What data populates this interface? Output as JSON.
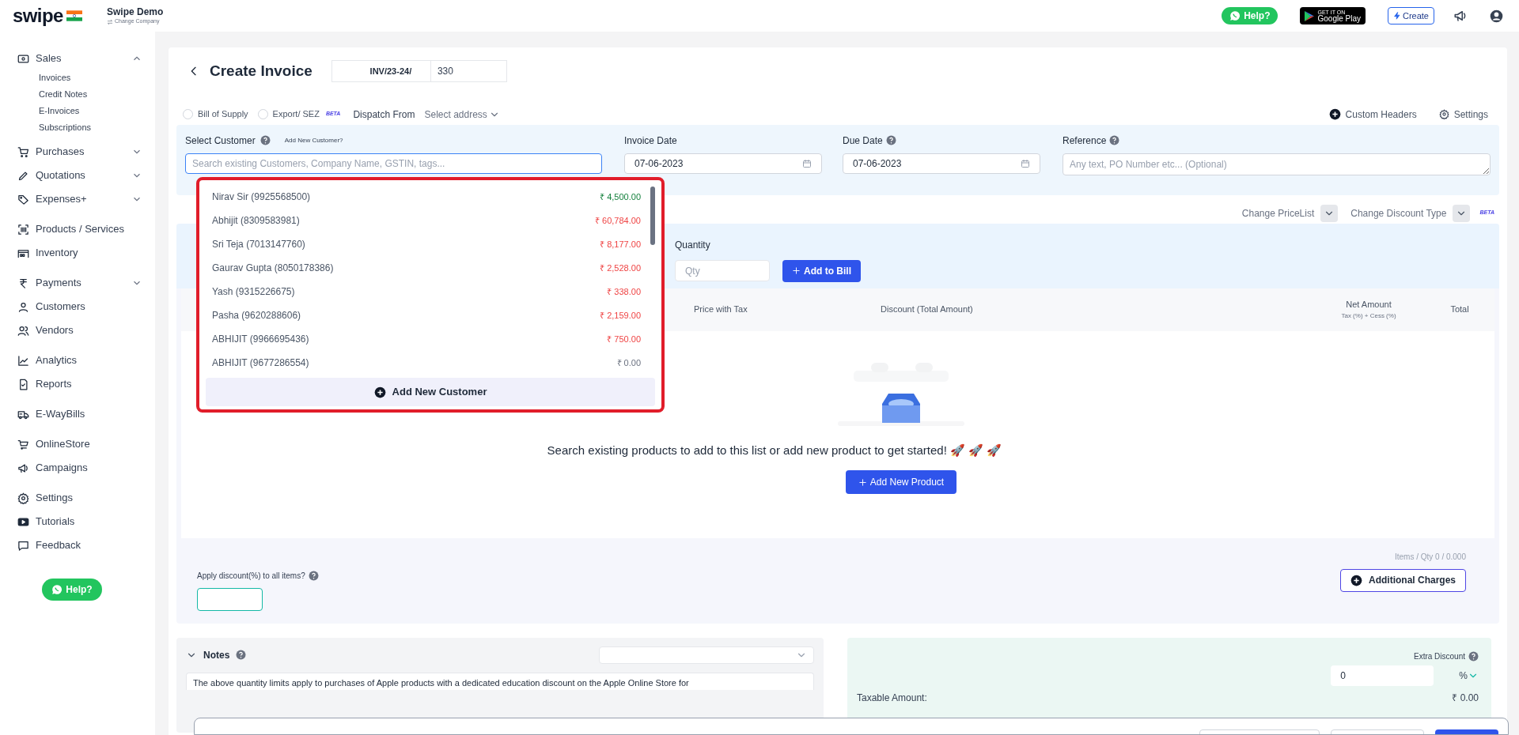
{
  "brand": {
    "logo": "swipe",
    "company": "Swipe Demo",
    "switch_link": "Change Company"
  },
  "topbar": {
    "help": "Help?",
    "store_small": "GET IT ON",
    "store": "Google Play",
    "create": "Create"
  },
  "sidebar": {
    "groups": [
      [
        {
          "label": "Sales",
          "expanded": true,
          "children": [
            "Invoices",
            "Credit Notes",
            "E-Invoices",
            "Subscriptions"
          ]
        },
        {
          "label": "Purchases",
          "expanded": false
        },
        {
          "label": "Quotations",
          "expanded": false
        },
        {
          "label": "Expenses+",
          "expanded": false
        }
      ],
      [
        {
          "label": "Products / Services"
        },
        {
          "label": "Inventory"
        }
      ],
      [
        {
          "label": "Payments",
          "expanded": false
        },
        {
          "label": "Customers"
        },
        {
          "label": "Vendors"
        }
      ],
      [
        {
          "label": "Analytics"
        },
        {
          "label": "Reports"
        }
      ],
      [
        {
          "label": "E-WayBills"
        }
      ],
      [
        {
          "label": "OnlineStore"
        },
        {
          "label": "Campaigns"
        }
      ],
      [
        {
          "label": "Settings"
        },
        {
          "label": "Tutorials"
        },
        {
          "label": "Feedback"
        }
      ]
    ],
    "help": "Help?"
  },
  "page": {
    "title": "Create Invoice",
    "prefix": "INV/23-24/",
    "number": "330"
  },
  "options": {
    "radios": [
      {
        "label": "Bill of Supply",
        "selected": false
      },
      {
        "label": "Export/ SEZ",
        "selected": false
      }
    ],
    "beta": "BETA",
    "dispatch_label": "Dispatch From",
    "dispatch_value": "Select address",
    "custom_headers": "Custom Headers",
    "settings": "Settings"
  },
  "customer": {
    "label": "Select Customer",
    "add_link": "Add New Customer?",
    "placeholder": "Search existing Customers, Company Name, GSTIN, tags..."
  },
  "invoice_date": {
    "label": "Invoice Date",
    "value": "07-06-2023"
  },
  "due_date": {
    "label": "Due Date",
    "value": "07-06-2023"
  },
  "reference": {
    "label": "Reference",
    "placeholder": "Any text, PO Number etc... (Optional)"
  },
  "dropdown": {
    "items": [
      {
        "name": "Nirav Sir (9925568500)",
        "amount": "₹ 4,500.00",
        "color": "#15803d"
      },
      {
        "name": "Abhijit (8309583981)",
        "amount": "₹ 60,784.00",
        "color": "#ef4444"
      },
      {
        "name": "Sri Teja (7013147760)",
        "amount": "₹ 8,177.00",
        "color": "#ef4444"
      },
      {
        "name": "Gaurav Gupta (8050178386)",
        "amount": "₹ 2,528.00",
        "color": "#ef4444"
      },
      {
        "name": "Yash (9315226675)",
        "amount": "₹ 338.00",
        "color": "#ef4444"
      },
      {
        "name": "Pasha (9620288606)",
        "amount": "₹ 2,159.00",
        "color": "#ef4444"
      },
      {
        "name": "ABHIJIT (9966695436)",
        "amount": "₹ 750.00",
        "color": "#ef4444"
      },
      {
        "name": "ABHIJIT (9677286554)",
        "amount": "₹ 0.00",
        "color": "#6b7280"
      }
    ],
    "add_button": "Add New Customer"
  },
  "pricing": {
    "pricelist": "Change PriceList",
    "discount_type": "Change Discount Type",
    "beta": "BETA"
  },
  "products": {
    "quantity_label": "Quantity",
    "qty_placeholder": "Qty",
    "add_to_bill": "Add to Bill",
    "columns": [
      {
        "label": "Price with Tax"
      },
      {
        "label": "Discount (Total Amount)"
      },
      {
        "label": "Net Amount",
        "sub": "Tax (%) + Cess (%)"
      },
      {
        "label": "Total"
      }
    ],
    "empty_message": "Search existing products to add to this list or add new product to get started! 🚀 🚀 🚀",
    "add_product": "Add New Product",
    "discount_label": "Apply discount(%) to all items?",
    "summary": "Items / Qty 0 / 0.000",
    "additional_charges": "Additional Charges"
  },
  "notes": {
    "title": "Notes",
    "expanded": true,
    "text": "The above quantity limits apply to purchases of Apple products with a dedicated education discount on the Apple Online Store for"
  },
  "totals": {
    "extra_discount_label": "Extra Discount",
    "extra_discount_value": "0",
    "unit": "%",
    "taxable_label": "Taxable Amount:",
    "taxable_value": "₹ 0.00"
  }
}
